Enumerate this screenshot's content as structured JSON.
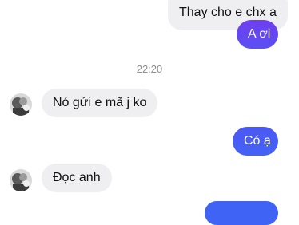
{
  "conversation": {
    "messages": [
      {
        "sender": "self",
        "text": "Thay cho e chx a"
      },
      {
        "sender": "self",
        "text": "A ơi"
      },
      {
        "type": "timestamp",
        "text": "22:20"
      },
      {
        "sender": "contact",
        "text": "Nó gửi e mã j ko"
      },
      {
        "sender": "self",
        "text": "Có ạ"
      },
      {
        "sender": "contact",
        "text": "Đọc anh"
      }
    ]
  },
  "theme": {
    "incoming_bubble": "#efeff1",
    "outgoing_gradient_top": "#6a43f0",
    "outgoing_gradient_bottom": "#3f63f5",
    "timestamp_color": "#8e8e93"
  },
  "contact": {
    "avatar_icon": "user-avatar-photo"
  }
}
